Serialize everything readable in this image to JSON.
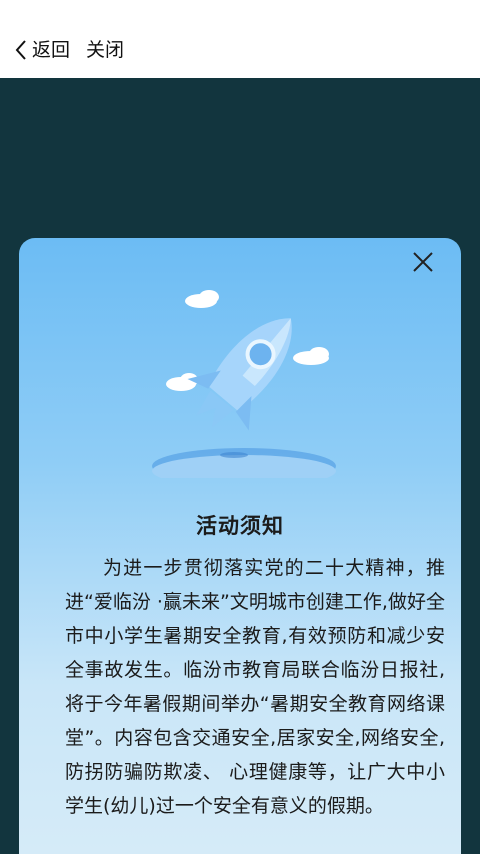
{
  "topbar": {
    "back_label": "返回",
    "close_label": "关闭"
  },
  "modal": {
    "title": "活动须知",
    "body": "为进一步贯彻落实党的二十大精神，推进“爱临汾 ·赢未来”文明城市创建工作,做好全市中小学生暑期安全教育,有效预防和减少安全事故发生。临汾市教育局联合临汾日报社,将于今年暑假期间举办“暑期安全教育网络课堂”。内容包含交通安全,居家安全,网络安全,防拐防骗防欺凌、 心理健康等，让广大中小学生(幼儿)过一个安全有意义的假期。"
  },
  "colors": {
    "overlay": "#12353e",
    "card_top": "#6cbcf4",
    "card_bottom": "#d7ecf8"
  }
}
